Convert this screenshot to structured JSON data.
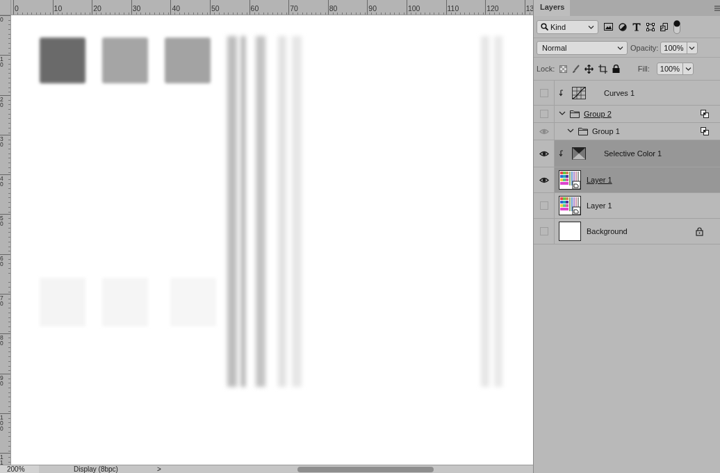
{
  "rulers": {
    "horizontal": [
      "0",
      "10",
      "20",
      "30",
      "40",
      "50",
      "60",
      "70",
      "80",
      "90",
      "100",
      "110",
      "120",
      "13"
    ],
    "vertical": [
      "0",
      "10",
      "20",
      "30",
      "40",
      "50",
      "60",
      "70",
      "80",
      "90",
      "100",
      "11"
    ]
  },
  "layers_panel": {
    "tab": "Layers",
    "filter": {
      "value": "Kind",
      "on": true
    },
    "blend_mode": "Normal",
    "opacity_label": "Opacity:",
    "opacity": "100%",
    "lock_label": "Lock:",
    "fill_label": "Fill:",
    "fill": "100%",
    "layers": [
      {
        "name": "Curves 1",
        "kind": "curves",
        "visible": false,
        "selected": false,
        "clipped": true,
        "linked": false,
        "locked": false
      },
      {
        "name": "Group 2",
        "kind": "group",
        "visible": false,
        "selected": false,
        "clipped": false,
        "linked": true,
        "locked": false,
        "expanded": true,
        "children": [
          {
            "name": "Group 1",
            "kind": "group",
            "visible": true,
            "selected": false,
            "clipped": false,
            "linked": false,
            "locked": false,
            "expanded": true
          }
        ]
      },
      {
        "name": "Selective Color 1",
        "kind": "selective-color",
        "visible": true,
        "selected": true,
        "clipped": true,
        "linked": false,
        "locked": false
      },
      {
        "name": "Layer 1",
        "kind": "smart-object",
        "visible": true,
        "selected": true,
        "clipped": false,
        "linked": true,
        "locked": false
      },
      {
        "name": "Layer 1",
        "kind": "smart-object",
        "visible": false,
        "selected": false,
        "clipped": false,
        "linked": false,
        "locked": false
      },
      {
        "name": "Background",
        "kind": "background",
        "visible": false,
        "selected": false,
        "clipped": false,
        "linked": false,
        "locked": true
      }
    ]
  },
  "status_bar": {
    "zoom": "200%",
    "info": "Display (8bpc)",
    "arrow": ">"
  }
}
